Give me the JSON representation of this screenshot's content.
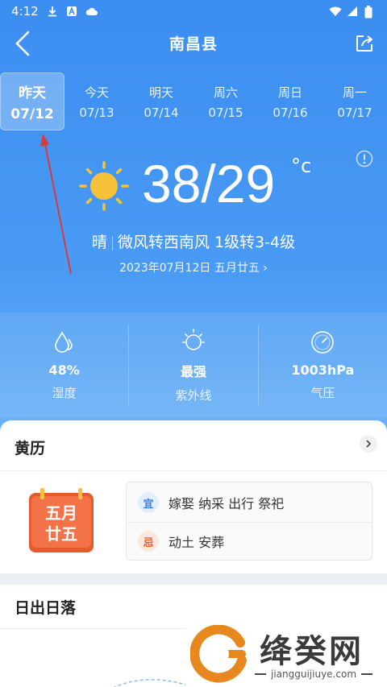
{
  "status_bar": {
    "time": "4:12"
  },
  "header": {
    "city": "南昌县"
  },
  "days": [
    {
      "name": "昨天",
      "date": "07/12",
      "selected": true
    },
    {
      "name": "今天",
      "date": "07/13",
      "selected": false
    },
    {
      "name": "明天",
      "date": "07/14",
      "selected": false
    },
    {
      "name": "周六",
      "date": "07/15",
      "selected": false
    },
    {
      "name": "周日",
      "date": "07/16",
      "selected": false
    },
    {
      "name": "周一",
      "date": "07/17",
      "selected": false
    }
  ],
  "weather": {
    "icon": "sun-icon",
    "temp": "38/29",
    "unit": "°c",
    "condition": "晴",
    "wind": "微风转西南风 1级转3-4级",
    "date_line": "2023年07月12日 五月廿五"
  },
  "stats": [
    {
      "icon": "humidity-icon",
      "value": "48%",
      "label": "湿度"
    },
    {
      "icon": "uv-icon",
      "value": "最强",
      "label": "紫外线"
    },
    {
      "icon": "pressure-icon",
      "value": "1003hPa",
      "label": "气压"
    }
  ],
  "huangli": {
    "title": "黄历",
    "cal_text_1": "五月",
    "cal_text_2": "廿五",
    "yi_badge": "宜",
    "yi_items": "嫁娶 纳采 出行 祭祀",
    "ji_badge": "忌",
    "ji_items": "动土 安葬"
  },
  "sunrise": {
    "title": "日出日落"
  },
  "watermark": {
    "title": "绛癸网",
    "subtitle": "jiangguijiuye.com"
  },
  "colors": {
    "bg_top": "#3b8df1",
    "accent_red": "#e85a2c",
    "sun_yellow": "#f6c23a"
  }
}
